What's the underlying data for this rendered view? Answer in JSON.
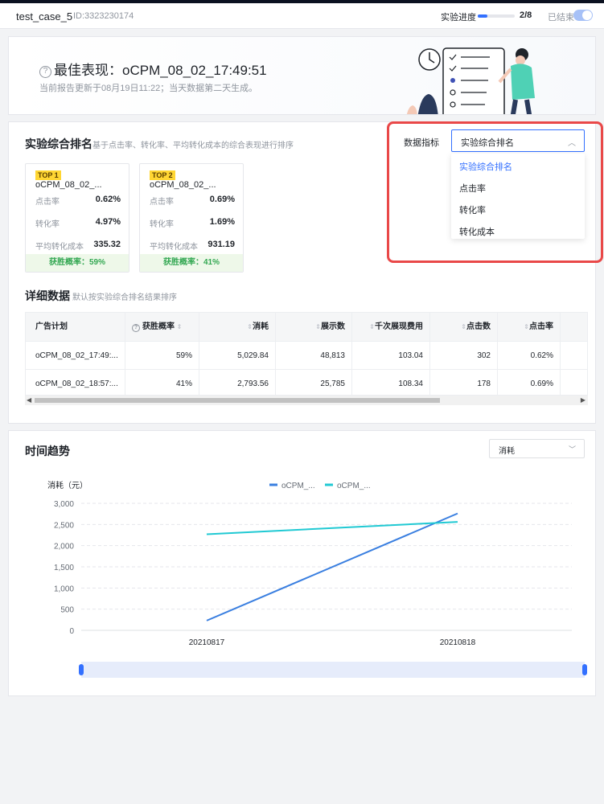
{
  "header": {
    "title": "test_case_5",
    "id": "ID:3323230174",
    "progress_label": "实验进度",
    "progress_value": "2/8",
    "progress_fraction": 0.25,
    "ended_label": "已结束"
  },
  "best": {
    "title": "最佳表现：oCPM_08_02_17:49:51",
    "subtitle": "当前报告更新于08月19日11:22；当天数据第二天生成。"
  },
  "ranking": {
    "title": "实验综合排名",
    "description": "基于点击率、转化率、平均转化成本的综合表现进行排序",
    "metric_label": "数据指标",
    "selected": "实验综合排名",
    "options": [
      "实验综合排名",
      "点击率",
      "转化率",
      "转化成本"
    ],
    "cards": [
      {
        "badge": "TOP 1",
        "name": "oCPM_08_02_...",
        "rows": [
          {
            "k": "点击率",
            "v": "0.62%"
          },
          {
            "k": "转化率",
            "v": "4.97%"
          },
          {
            "k": "平均转化成本",
            "v": "335.32"
          }
        ],
        "footer": "获胜概率：59%"
      },
      {
        "badge": "TOP 2",
        "name": "oCPM_08_02_...",
        "rows": [
          {
            "k": "点击率",
            "v": "0.69%"
          },
          {
            "k": "转化率",
            "v": "1.69%"
          },
          {
            "k": "平均转化成本",
            "v": "931.19"
          }
        ],
        "footer": "获胜概率：41%"
      }
    ]
  },
  "detail": {
    "title": "详细数据",
    "description": "默认按实验综合排名结果排序",
    "columns": [
      "广告计划",
      "获胜概率",
      "消耗",
      "展示数",
      "千次展现费用",
      "点击数",
      "点击率"
    ],
    "rows": [
      [
        "oCPM_08_02_17:49:...",
        "59%",
        "5,029.84",
        "48,813",
        "103.04",
        "302",
        "0.62%"
      ],
      [
        "oCPM_08_02_18:57:...",
        "41%",
        "2,793.56",
        "25,785",
        "108.34",
        "178",
        "0.69%"
      ]
    ]
  },
  "trend": {
    "title": "时间趋势",
    "selected": "消耗"
  },
  "chart_data": {
    "type": "line",
    "ylabel": "消耗（元）",
    "x": [
      "20210817",
      "20210818"
    ],
    "ylim": [
      0,
      3000
    ],
    "yticks": [
      "3,000",
      "2,500",
      "2,000",
      "1,500",
      "1,000",
      "500",
      "0"
    ],
    "legend_position": "top",
    "series": [
      {
        "name": "oCPM_...",
        "color": "#3a7fe0",
        "values": [
          230,
          2760
        ]
      },
      {
        "name": "oCPM_...",
        "color": "#20c9d3",
        "values": [
          2270,
          2560
        ]
      }
    ]
  }
}
